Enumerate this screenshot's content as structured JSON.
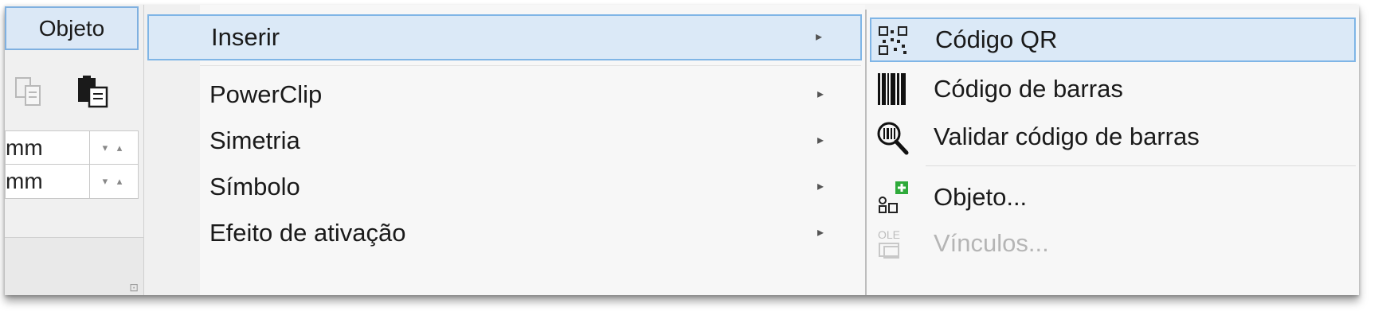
{
  "left": {
    "tab_label": "Objeto",
    "fields": [
      {
        "unit": "mm"
      },
      {
        "unit": "mm"
      }
    ],
    "spin_arrows": "▾ ▴",
    "corner_mark": "⊡"
  },
  "menu": {
    "items": [
      {
        "label": "Inserir",
        "highlighted": true
      },
      {
        "label": "PowerClip"
      },
      {
        "label": "Simetria"
      },
      {
        "label": "Símbolo"
      },
      {
        "label": "Efeito de ativação"
      }
    ],
    "arrow_glyph": "▸"
  },
  "submenu": {
    "items": [
      {
        "label": "Código QR",
        "icon": "qr-code-icon",
        "highlighted": true
      },
      {
        "label": "Código de barras",
        "icon": "barcode-icon"
      },
      {
        "label": "Validar código de barras",
        "icon": "barcode-validate-icon"
      },
      {
        "label": "Objeto...",
        "icon": "insert-object-icon"
      },
      {
        "label": "Vínculos...",
        "icon": "ole-links-icon",
        "disabled": true
      }
    ]
  },
  "colors": {
    "highlight_bg": "#dbe9f7",
    "highlight_border": "#7fb5e6",
    "accent_green": "#2eaa3a"
  }
}
